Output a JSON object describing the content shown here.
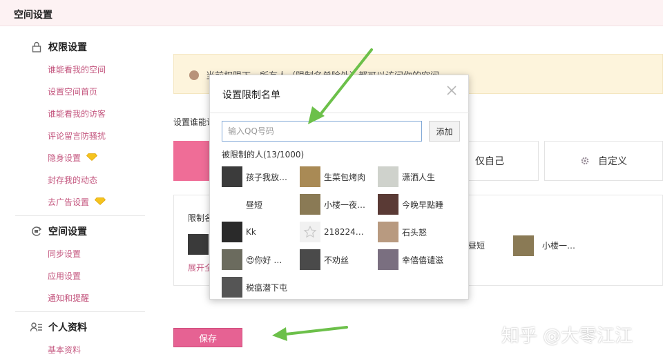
{
  "header": {
    "title": "空间设置"
  },
  "sidebar": {
    "groups": [
      {
        "title": "权限设置",
        "icon": "lock-icon",
        "items": [
          {
            "label": "谁能看我的空间"
          },
          {
            "label": "设置空间首页"
          },
          {
            "label": "谁能看我的访客"
          },
          {
            "label": "评论留言防骚扰"
          },
          {
            "label": "隐身设置",
            "badge": "diamond-icon"
          },
          {
            "label": "封存我的动态"
          },
          {
            "label": "去广告设置",
            "badge": "diamond-icon"
          }
        ]
      },
      {
        "title": "空间设置",
        "icon": "sync-icon",
        "items": [
          {
            "label": "同步设置"
          },
          {
            "label": "应用设置"
          },
          {
            "label": "通知和提醒"
          }
        ]
      },
      {
        "title": "个人资料",
        "icon": "user-list-icon",
        "items": [
          {
            "label": "基本资料"
          }
        ]
      }
    ]
  },
  "main": {
    "notice": "当前权限下，所有人（限制名单除外）都可以访问你的空间",
    "who_label": "设置谁能访问",
    "options": [
      {
        "label": "仅自己",
        "icon": ""
      },
      {
        "label": "自定义",
        "icon": "gear-icon"
      }
    ],
    "restrict_label": "限制名单",
    "restrict_more": "展开全部",
    "restrict_people": [
      {
        "name": "昼短"
      },
      {
        "name": "小楼一…"
      }
    ],
    "save_label": "保存"
  },
  "dialog": {
    "title": "设置限制名单",
    "input_placeholder": "输入QQ号码",
    "add_label": "添加",
    "count_label": "被限制的人(13/1000)",
    "people": [
      {
        "name": "孩子我放…"
      },
      {
        "name": "生菜包烤肉"
      },
      {
        "name": "潇洒人生"
      },
      {
        "name": "昼短"
      },
      {
        "name": "小楼一夜…"
      },
      {
        "name": "今晚早點睡"
      },
      {
        "name": "Kk"
      },
      {
        "name": "218224…"
      },
      {
        "name": "石头怒"
      },
      {
        "name": "😍你好 …"
      },
      {
        "name": "不劝丝"
      },
      {
        "name": "幸僖僖谴滋"
      },
      {
        "name": "税瘟潜下屯"
      }
    ]
  },
  "watermark": "知乎 @大零江江",
  "colors": {
    "accent": "#e66293",
    "link": "#c4577f",
    "arrow": "#6cc04a",
    "notice_bg": "#fdf4dc"
  }
}
